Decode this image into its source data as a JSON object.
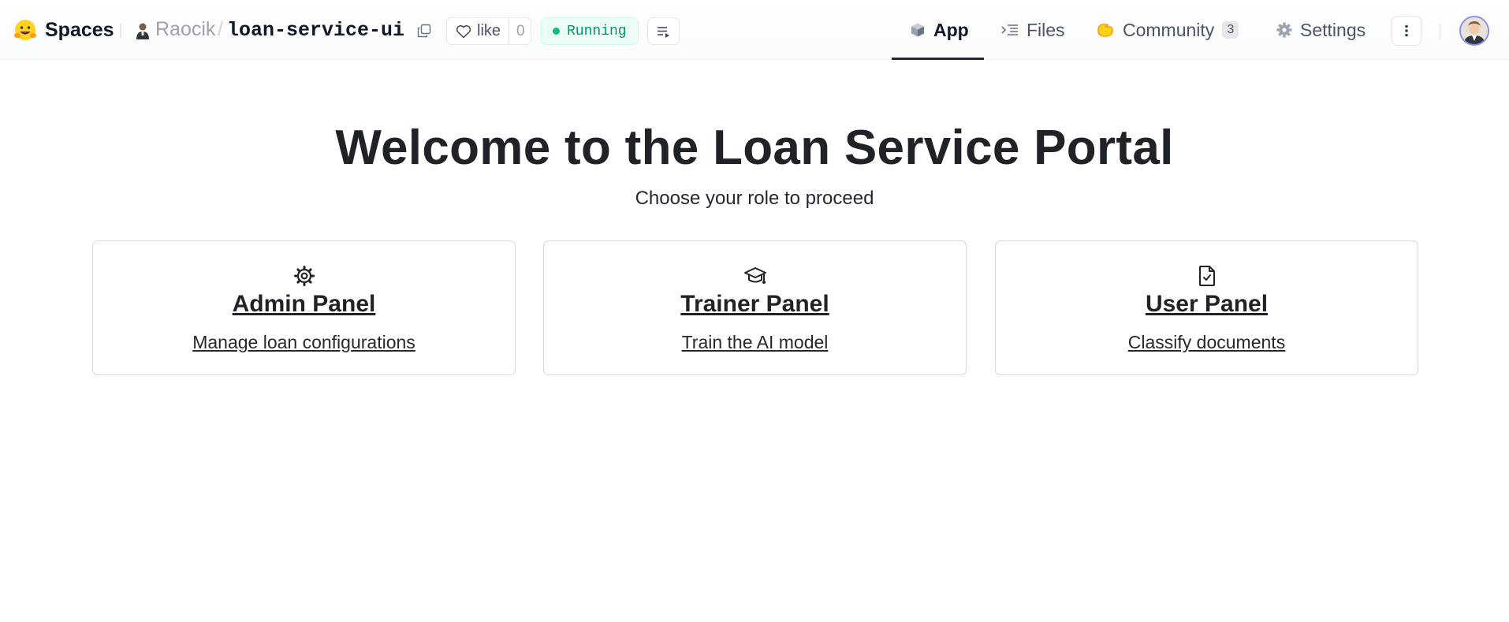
{
  "header": {
    "brand": "Spaces",
    "owner": "Raocik",
    "separator": "/",
    "repo": "loan-service-ui",
    "like_label": "like",
    "like_count": "0",
    "status": "Running",
    "tabs": [
      {
        "label": "App",
        "icon": "cube-icon",
        "active": true
      },
      {
        "label": "Files",
        "icon": "files-icon",
        "active": false
      },
      {
        "label": "Community",
        "icon": "community-hands-icon",
        "badge": "3",
        "active": false
      },
      {
        "label": "Settings",
        "icon": "gear-icon",
        "active": false
      }
    ]
  },
  "main": {
    "title": "Welcome to the Loan Service Portal",
    "subtitle": "Choose your role to proceed",
    "cards": [
      {
        "title": "Admin Panel",
        "description": "Manage loan configurations",
        "icon": "gear-icon"
      },
      {
        "title": "Trainer Panel",
        "description": "Train the AI model",
        "icon": "graduation-cap-icon"
      },
      {
        "title": "User Panel",
        "description": "Classify documents",
        "icon": "document-check-icon"
      }
    ]
  },
  "colors": {
    "status_green": "#10b981",
    "status_bg": "#ecfdf5",
    "brand_yellow": "#FFD21E",
    "avatar_ring": "#8b8fe6"
  }
}
